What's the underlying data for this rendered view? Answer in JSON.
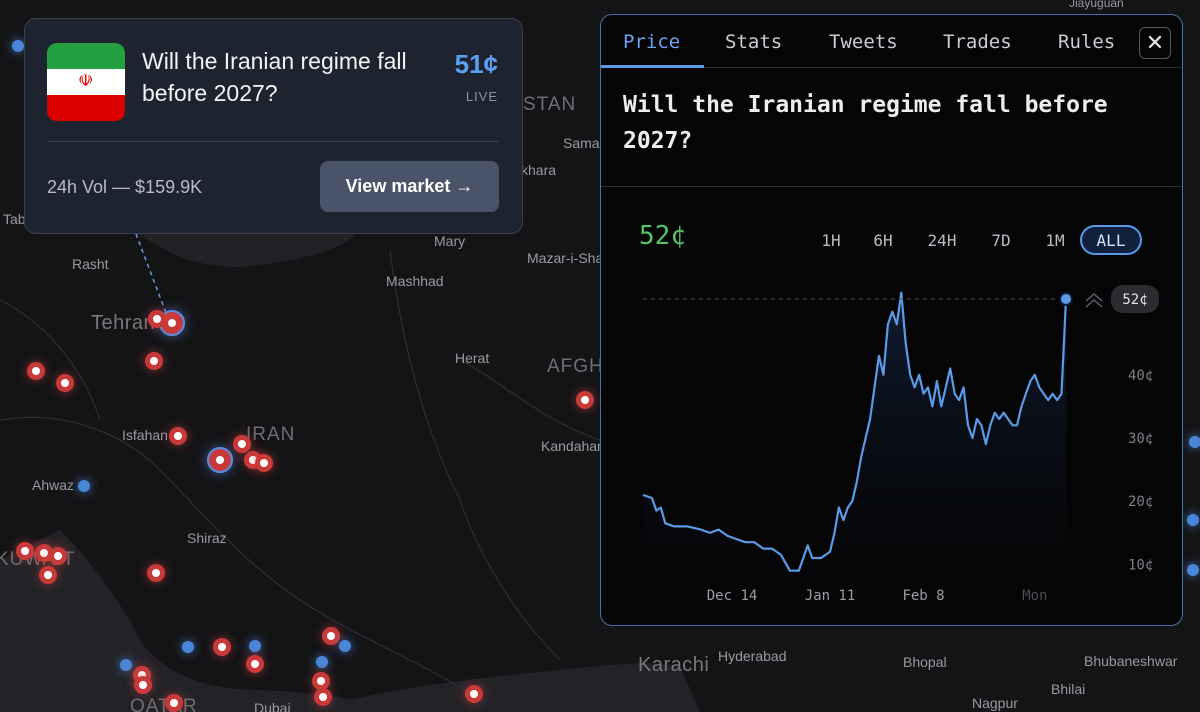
{
  "map": {
    "labels": [
      {
        "key": "tehran",
        "text": "Tehran"
      },
      {
        "key": "rasht",
        "text": "Rasht"
      },
      {
        "key": "mashhad",
        "text": "Mashhad"
      },
      {
        "key": "mary",
        "text": "Mary"
      },
      {
        "key": "herat",
        "text": "Herat"
      },
      {
        "key": "isfahan",
        "text": "Isfahan"
      },
      {
        "key": "iran",
        "text": "IRAN"
      },
      {
        "key": "ahwaz",
        "text": "Ahwaz"
      },
      {
        "key": "shiraz",
        "text": "Shiraz"
      },
      {
        "key": "kuwait",
        "text": "KUWAIT"
      },
      {
        "key": "qatar",
        "text": "QATAR"
      },
      {
        "key": "dubai",
        "text": "Dubai"
      },
      {
        "key": "kandahar",
        "text": "Kandahar"
      },
      {
        "key": "afgh",
        "text": "AFGH"
      },
      {
        "key": "mazar",
        "text": "Mazar-i-Sha"
      },
      {
        "key": "sama",
        "text": "Sama"
      },
      {
        "key": "khara",
        "text": "khara"
      },
      {
        "key": "stan",
        "text": "STAN"
      },
      {
        "key": "tab",
        "text": "Tab"
      },
      {
        "key": "karachi",
        "text": "Karachi"
      },
      {
        "key": "hyderabad",
        "text": "Hyderabad"
      },
      {
        "key": "bhopal",
        "text": "Bhopal"
      },
      {
        "key": "bhubaneshwar",
        "text": "Bhubaneshwar"
      },
      {
        "key": "nagpur",
        "text": "Nagpur"
      },
      {
        "key": "bhilai",
        "text": "Bhilai"
      },
      {
        "key": "jiayuguan",
        "text": "Jiayuguan"
      }
    ]
  },
  "market_card": {
    "title": "Will the Iranian regime fall before 2027?",
    "price": "51¢",
    "status": "LIVE",
    "volume": "24h Vol — $159.9K",
    "button_label": "View market →",
    "flag_colors": [
      "#239f40",
      "#ffffff",
      "#da0000"
    ]
  },
  "panel": {
    "tabs": [
      "Price",
      "Stats",
      "Tweets",
      "Trades",
      "Rules"
    ],
    "active_tab": "Price",
    "close_icon": "close-icon",
    "title": "Will the Iranian regime fall before 2027?",
    "current_price": "52¢",
    "ranges": [
      "1H",
      "6H",
      "24H",
      "7D",
      "1M",
      "ALL"
    ],
    "active_range": "ALL"
  },
  "chart_data": {
    "type": "line",
    "x_ticks": [
      "Dec 14",
      "Jan 11",
      "Feb 8",
      "Mon"
    ],
    "y_ticks": [
      "10¢",
      "20¢",
      "30¢",
      "40¢"
    ],
    "y_unit": "¢",
    "ylim": [
      8,
      55
    ],
    "last_value_label": "52¢",
    "series": [
      {
        "color": "#5a9ae8",
        "points": [
          [
            0,
            21
          ],
          [
            2,
            20.5
          ],
          [
            3,
            18.5
          ],
          [
            4,
            19
          ],
          [
            5,
            16.5
          ],
          [
            7,
            16
          ],
          [
            10,
            16
          ],
          [
            13,
            15.5
          ],
          [
            15,
            15
          ],
          [
            17,
            15.5
          ],
          [
            19,
            14.5
          ],
          [
            21,
            14
          ],
          [
            23,
            13.5
          ],
          [
            25,
            13.5
          ],
          [
            27,
            12.5
          ],
          [
            29,
            12.5
          ],
          [
            31,
            11.5
          ],
          [
            33,
            9
          ],
          [
            35,
            9
          ],
          [
            36,
            11
          ],
          [
            37,
            13
          ],
          [
            38,
            11
          ],
          [
            40,
            11
          ],
          [
            42,
            12
          ],
          [
            43,
            15
          ],
          [
            44,
            19
          ],
          [
            45,
            17
          ],
          [
            46,
            19
          ],
          [
            47,
            20
          ],
          [
            48,
            23
          ],
          [
            49,
            27
          ],
          [
            50,
            30
          ],
          [
            51,
            33
          ],
          [
            52,
            38
          ],
          [
            53,
            43
          ],
          [
            54,
            40
          ],
          [
            55,
            48
          ],
          [
            56,
            50
          ],
          [
            57,
            48
          ],
          [
            58,
            53
          ],
          [
            59,
            45
          ],
          [
            60,
            40
          ],
          [
            61,
            38
          ],
          [
            62,
            40
          ],
          [
            63,
            37
          ],
          [
            64,
            38
          ],
          [
            65,
            35
          ],
          [
            66,
            39
          ],
          [
            67,
            35
          ],
          [
            68,
            38
          ],
          [
            69,
            41
          ],
          [
            70,
            37
          ],
          [
            71,
            36
          ],
          [
            72,
            38
          ],
          [
            73,
            32
          ],
          [
            74,
            30
          ],
          [
            75,
            33
          ],
          [
            76,
            32
          ],
          [
            77,
            29
          ],
          [
            78,
            32
          ],
          [
            79,
            34
          ],
          [
            80,
            33
          ],
          [
            81,
            34
          ],
          [
            82,
            33
          ],
          [
            83,
            32
          ],
          [
            84,
            32
          ],
          [
            85,
            35
          ],
          [
            86,
            37
          ],
          [
            87,
            39
          ],
          [
            88,
            40
          ],
          [
            89,
            38
          ],
          [
            90,
            37
          ],
          [
            91,
            36
          ],
          [
            92,
            37
          ],
          [
            93,
            36
          ],
          [
            94,
            37
          ],
          [
            95,
            52
          ]
        ],
        "x_tick_positions": [
          20,
          42,
          63,
          88
        ]
      }
    ]
  }
}
